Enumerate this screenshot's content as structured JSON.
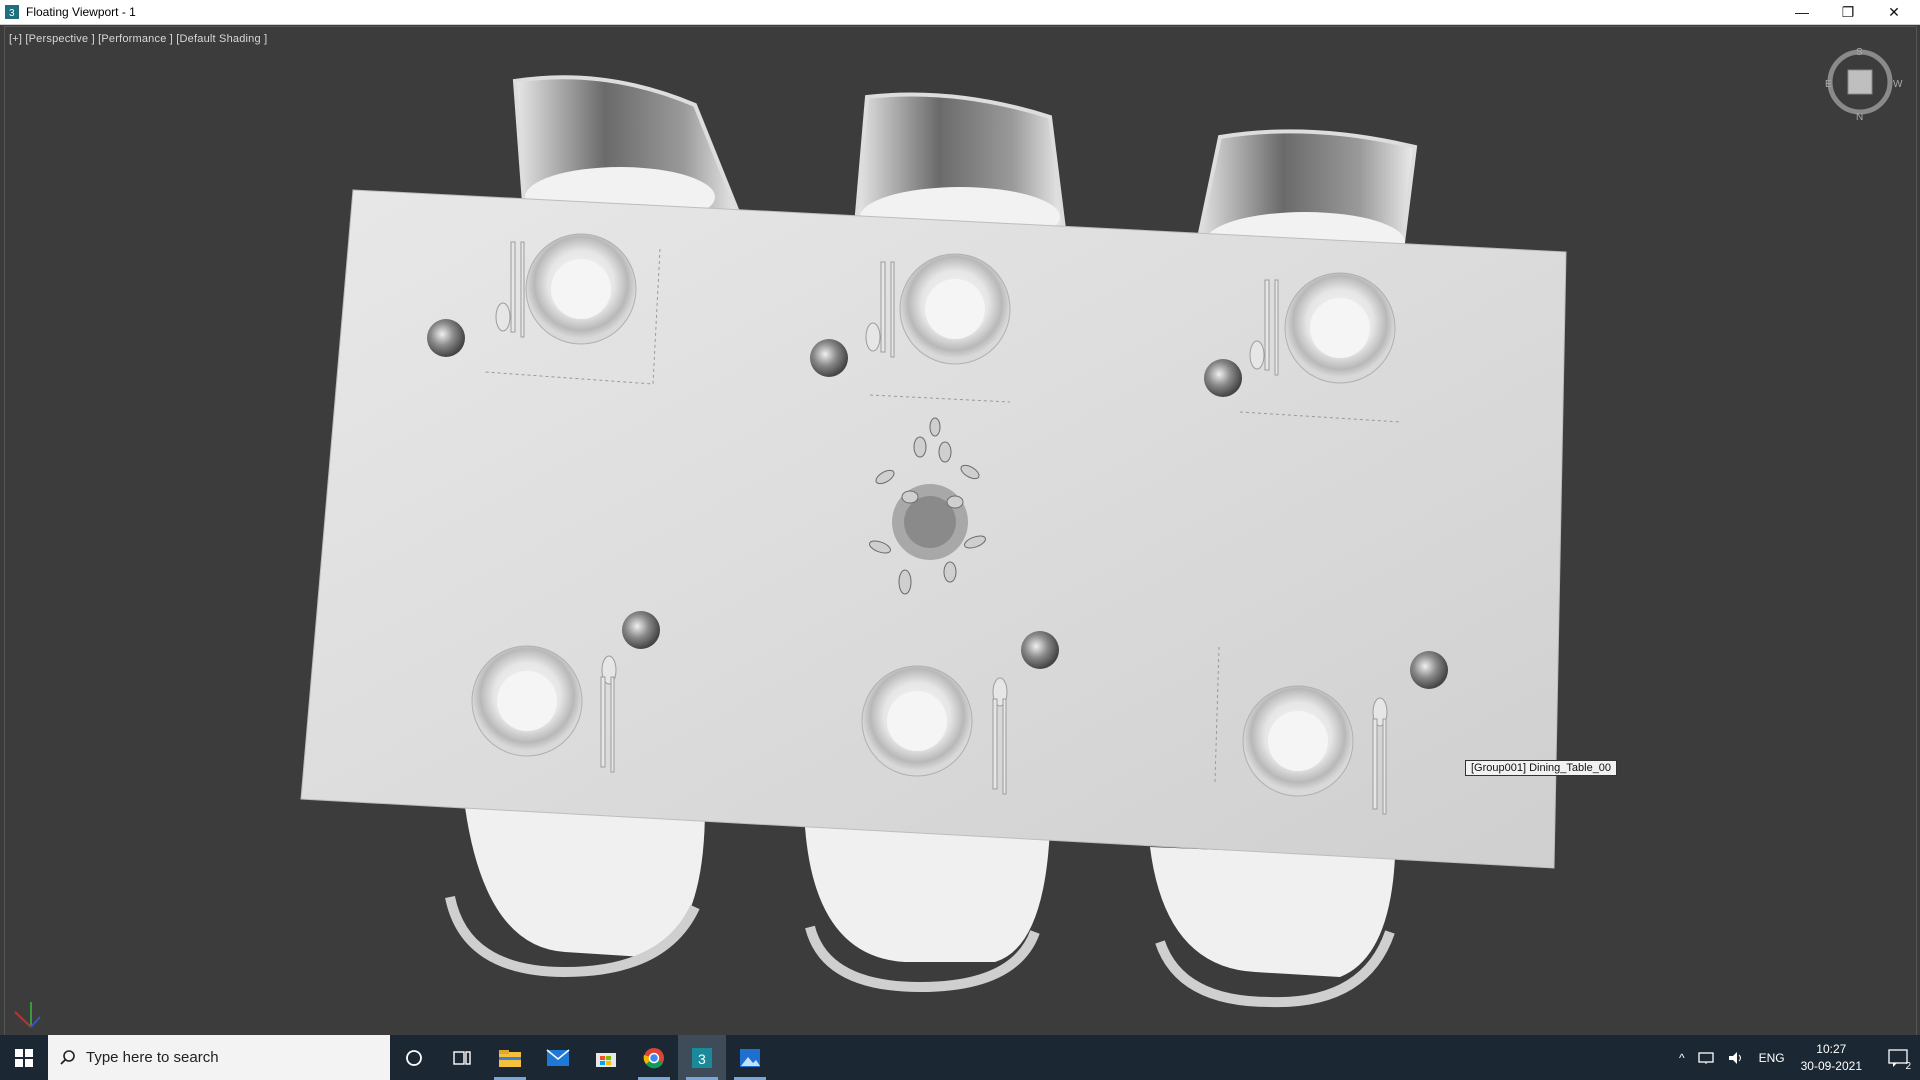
{
  "window": {
    "title": "Floating Viewport - 1",
    "controls": {
      "minimize": "—",
      "restore": "❐",
      "close": "✕"
    }
  },
  "viewport": {
    "label": "[+] [Perspective ] [Performance ] [Default Shading ]",
    "tooltip": "[Group001] Dining_Table_00",
    "viewcube": {
      "top": "S",
      "right": "W",
      "left": "E",
      "bottom": "N"
    },
    "shading_color": "#d9d9d9",
    "background_color": "#3c3c3c"
  },
  "taskbar": {
    "search_placeholder": "Type here to search",
    "apps": [
      "cortana-icon",
      "task-view-icon",
      "file-explorer-icon",
      "mail-icon",
      "store-icon",
      "chrome-icon",
      "3dsmax-icon",
      "photos-icon"
    ],
    "tray": {
      "language": "ENG",
      "time": "10:27",
      "date": "30-09-2021",
      "notifications": "2"
    }
  }
}
